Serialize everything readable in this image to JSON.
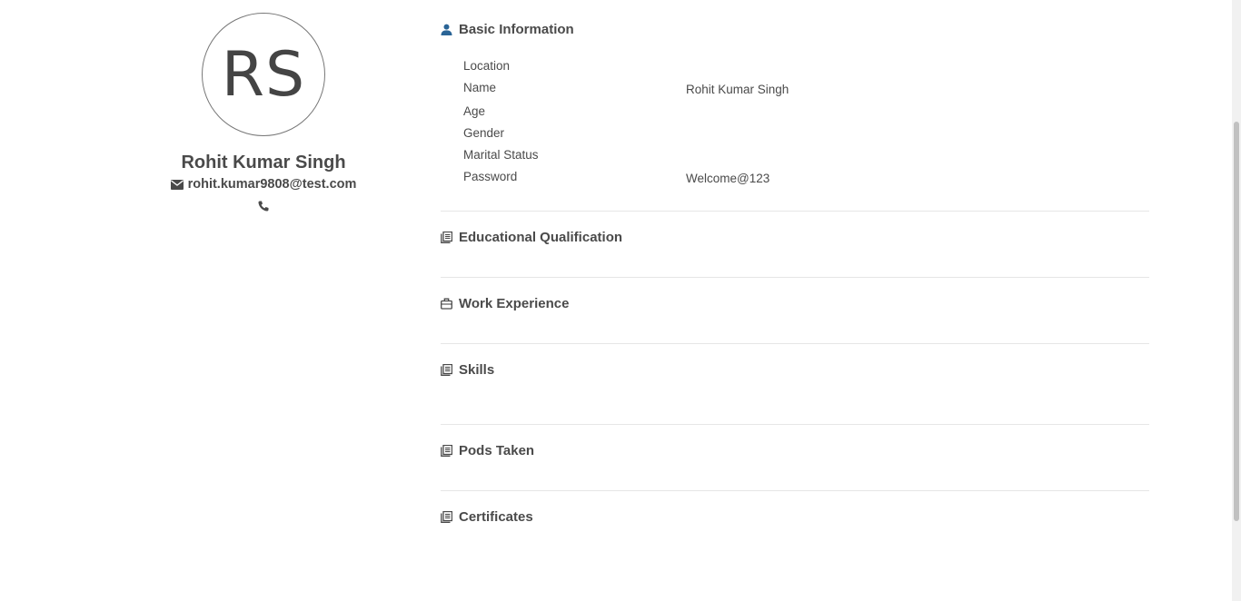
{
  "profile": {
    "initials": "RS",
    "name": "Rohit Kumar Singh",
    "email": "rohit.kumar9808@test.com"
  },
  "sections": {
    "basic": {
      "title": "Basic Information",
      "fields": [
        {
          "label": "Location",
          "value": ""
        },
        {
          "label": "Name",
          "value": "Rohit Kumar Singh"
        },
        {
          "label": "Age",
          "value": ""
        },
        {
          "label": "Gender",
          "value": ""
        },
        {
          "label": "Marital Status",
          "value": ""
        },
        {
          "label": "Password",
          "value": "Welcome@123"
        }
      ]
    },
    "education": {
      "title": "Educational Qualification"
    },
    "work": {
      "title": "Work Experience"
    },
    "skills": {
      "title": "Skills"
    },
    "pods": {
      "title": "Pods Taken"
    },
    "certificates": {
      "title": "Certificates"
    }
  },
  "icons": {
    "user": "user-icon",
    "envelope": "envelope-icon",
    "phone": "phone-icon",
    "book": "book-icon",
    "briefcase": "briefcase-icon"
  }
}
